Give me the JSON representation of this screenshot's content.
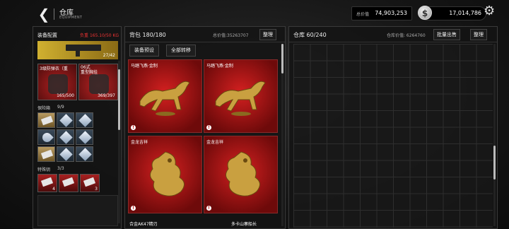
{
  "header": {
    "title": "仓库",
    "subtitle": "EQUIPMENT",
    "currency1_label": "总价值",
    "currency1_value": "74,903,253",
    "currency2_symbol": "$",
    "currency2_value": "17,014,786"
  },
  "left": {
    "title": "装备配置",
    "weight_label": "负重",
    "weight_value": "165.10/50 KG",
    "weapon_count": "27/42",
    "gear1_label": "3级防弹衣（重",
    "gear1_count": "165/500",
    "gear2_label": "06式\n重型胸挂",
    "gear2_count": "369/397",
    "safe_label": "保险箱",
    "safe_count": "9/9",
    "special_label": "特殊钥",
    "special_count": "3/3",
    "slot_a_count": "4",
    "slot_b_count": "3"
  },
  "backpack": {
    "title": "背包 180/180",
    "value": "总价值:35263707",
    "sort_label": "整理",
    "tab1": "装备预设",
    "tab2": "全部转移",
    "items": [
      {
        "name": "马踏飞燕·金制"
      },
      {
        "name": "马踏飞燕·金制"
      },
      {
        "name": "金龙吉祥"
      },
      {
        "name": "金龙吉祥"
      }
    ],
    "bottom1": "合金AK47精刃",
    "bottom2": "多卡山寨船长"
  },
  "storage": {
    "title": "仓库 60/240",
    "value": "仓库价值: 6264760",
    "sell_label": "批量出售",
    "sort_label": "整理"
  },
  "icons": {
    "back": "back-arrow-icon",
    "gear": "settings-gear-icon",
    "coin": "silver-coin-icon"
  }
}
